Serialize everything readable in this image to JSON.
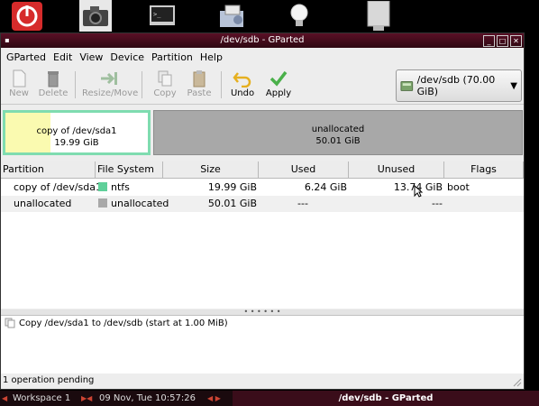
{
  "window": {
    "title": "/dev/sdb - GParted"
  },
  "menubar": [
    "GParted",
    "Edit",
    "View",
    "Device",
    "Partition",
    "Help"
  ],
  "toolbar": {
    "new": "New",
    "delete": "Delete",
    "resize_move": "Resize/Move",
    "copy": "Copy",
    "paste": "Paste",
    "undo": "Undo",
    "apply": "Apply"
  },
  "device_selector": {
    "value": "/dev/sdb   (70.00 GiB)"
  },
  "disk_map": {
    "partition": {
      "name": "copy of /dev/sda1",
      "size": "19.99 GiB"
    },
    "unallocated": {
      "name": "unallocated",
      "size": "50.01 GiB"
    }
  },
  "table": {
    "headers": [
      "Partition",
      "File System",
      "Size",
      "Used",
      "Unused",
      "Flags"
    ],
    "rows": [
      {
        "partition": "copy of /dev/sda1",
        "filesystem": "ntfs",
        "size": "19.99 GiB",
        "used": "6.24 GiB",
        "unused": "13.74 GiB",
        "flags": "boot",
        "fs_color": "#5fd09a"
      },
      {
        "partition": "unallocated",
        "filesystem": "unallocated",
        "size": "50.01 GiB",
        "used": "---",
        "unused": "---",
        "flags": "",
        "fs_color": "#a8a8a8"
      }
    ]
  },
  "operations": [
    "Copy /dev/sda1 to /dev/sdb (start at 1.00 MiB)"
  ],
  "statusbar": {
    "text": "1 operation pending"
  },
  "taskbar": {
    "workspace": "Workspace 1",
    "clock": "09 Nov, Tue 10:57:26",
    "active_task": "/dev/sdb - GParted"
  }
}
